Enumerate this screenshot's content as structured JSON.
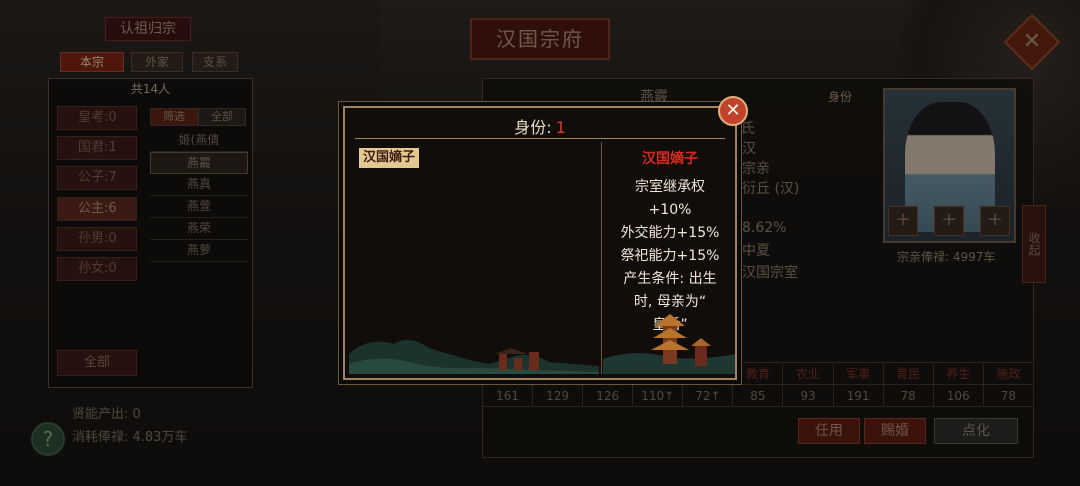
{
  "left": {
    "title": "认祖归宗",
    "tabs": [
      "本宗",
      "外家",
      "支系"
    ],
    "count": "共14人",
    "ranks": [
      "皇考:0",
      "国君:1",
      "公子:7",
      "公主:6",
      "孙男:0",
      "孙女:0"
    ],
    "all_button": "全部",
    "filter": [
      "筛选",
      "全部"
    ],
    "names": [
      "姬(燕倩",
      "燕霰",
      "燕真",
      "燕萱",
      "燕荣",
      "燕萝"
    ],
    "stats": [
      "贤能产出: 0",
      "消耗俸禄: 4.83万车"
    ],
    "help": "?"
  },
  "header": {
    "banner": "汉国宗府",
    "close": "✕"
  },
  "right": {
    "char_name": "燕霰",
    "info": [
      "姓 氏 姬姓燕氏",
      "汉",
      "宗亲",
      "衍丘 (汉)",
      "8.62%",
      "中夏",
      "汉国宗室"
    ],
    "identity_tag": "身份",
    "salary": "宗亲俸禄: 4997车",
    "collapse": "收起",
    "slot": "+",
    "attrs_header": [
      "",
      "",
      "",
      "",
      "",
      "教育",
      "农业",
      "军事",
      "育民",
      "养生",
      "施政"
    ],
    "attrs_values": [
      "161",
      "129",
      "126",
      "110↑",
      "72↑",
      "85",
      "93",
      "191",
      "78",
      "106",
      "78"
    ],
    "buttons": [
      "任用",
      "赐婚",
      "点化"
    ]
  },
  "modal": {
    "title_label": "身份:",
    "title_value": "1",
    "chip": "汉国嫡子",
    "detail_title": "汉国嫡子",
    "detail_lines": [
      "宗室继承权",
      "+10%",
      "外交能力+15%",
      "祭祀能力+15%",
      "产生条件: 出生",
      "时, 母亲为“",
      "皇后”"
    ],
    "close": "✕"
  }
}
